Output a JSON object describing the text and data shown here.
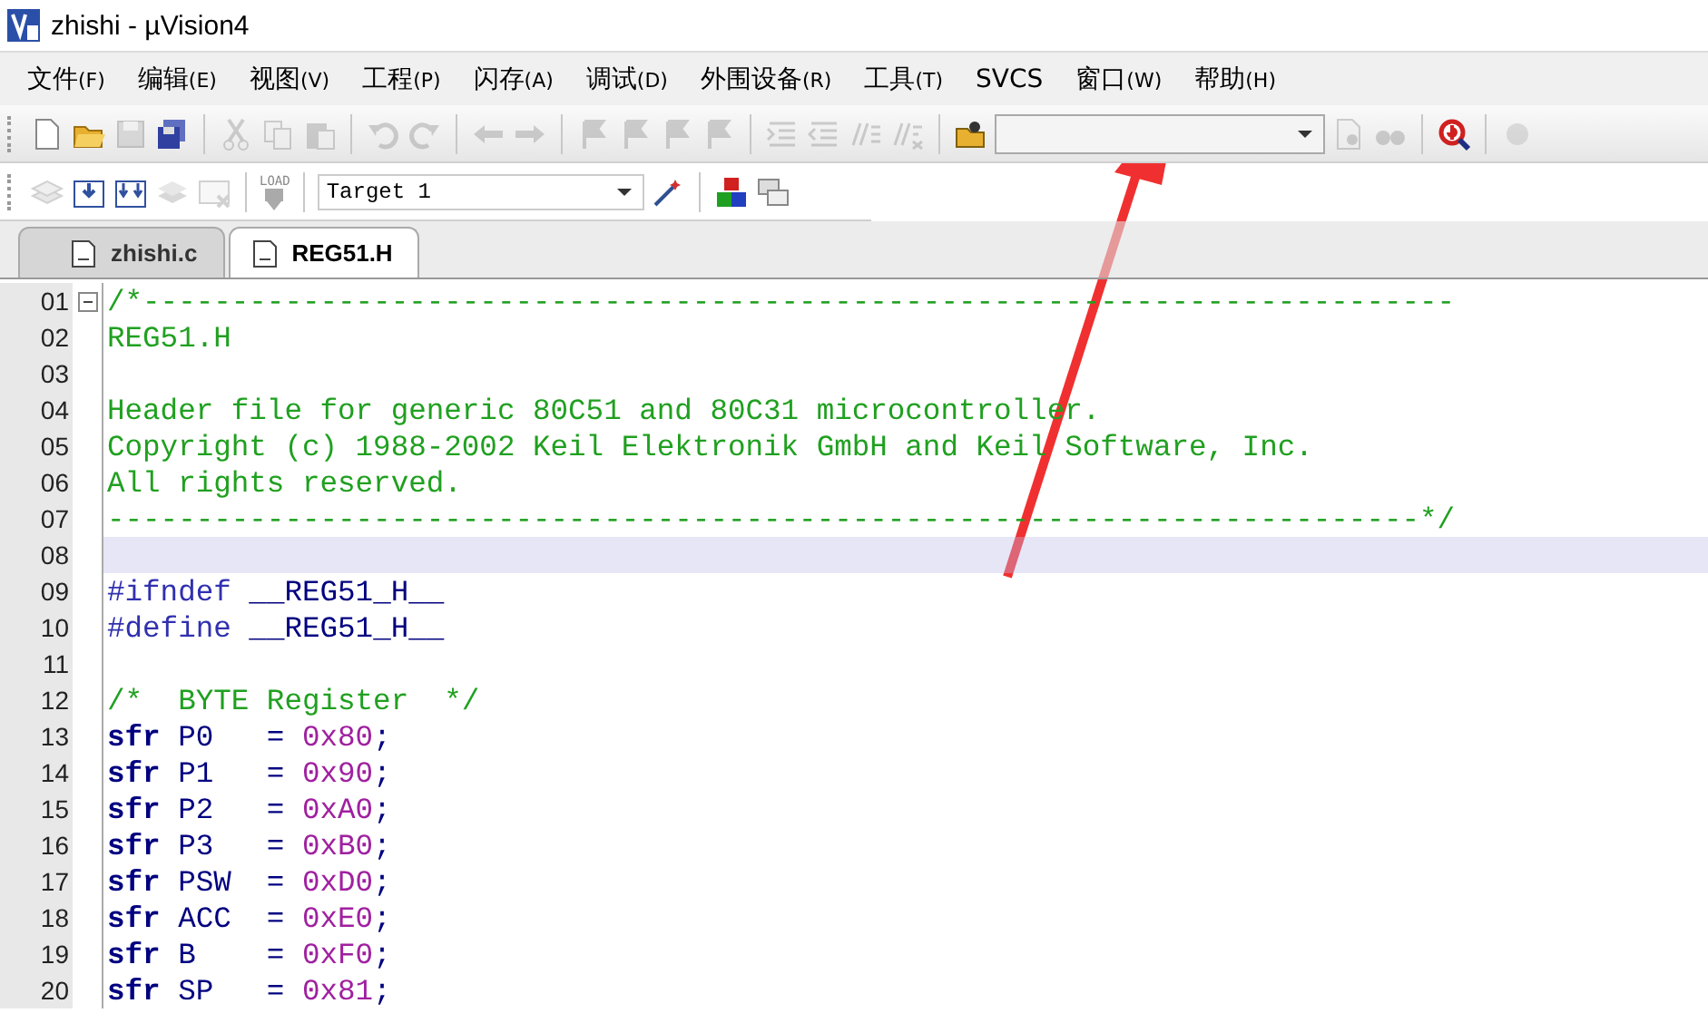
{
  "window": {
    "title": "zhishi  - µVision4"
  },
  "menu": [
    {
      "label": "文件",
      "key": "(F)"
    },
    {
      "label": "编辑",
      "key": "(E)"
    },
    {
      "label": "视图",
      "key": "(V)"
    },
    {
      "label": "工程",
      "key": "(P)"
    },
    {
      "label": "闪存",
      "key": "(A)"
    },
    {
      "label": "调试",
      "key": "(D)"
    },
    {
      "label": "外围设备",
      "key": "(R)"
    },
    {
      "label": "工具",
      "key": "(T)"
    },
    {
      "label": "SVCS"
    },
    {
      "label": "窗口",
      "key": "(W)"
    },
    {
      "label": "帮助",
      "key": "(H)"
    }
  ],
  "build_toolbar": {
    "load_label": "LOAD",
    "target": "Target 1"
  },
  "tabs": [
    {
      "label": "zhishi.c",
      "selected": false
    },
    {
      "label": "REG51.H",
      "selected": true
    }
  ],
  "editor": {
    "lines": [
      {
        "number": "01",
        "current": false,
        "fold": true,
        "tokens": [
          {
            "kind": "comment",
            "text": "/*--------------------------------------------------------------------------"
          }
        ]
      },
      {
        "number": "02",
        "current": false,
        "fold": false,
        "tokens": [
          {
            "kind": "comment",
            "text": "REG51.H"
          }
        ]
      },
      {
        "number": "03",
        "current": false,
        "fold": false
      },
      {
        "number": "04",
        "current": false,
        "fold": false,
        "tokens": [
          {
            "kind": "comment",
            "text": "Header file for generic 80C51 and 80C31 microcontroller."
          }
        ]
      },
      {
        "number": "05",
        "current": false,
        "fold": false,
        "tokens": [
          {
            "kind": "comment",
            "text": "Copyright (c) 1988-2002 Keil Elektronik GmbH and Keil Software, Inc."
          }
        ]
      },
      {
        "number": "06",
        "current": false,
        "fold": false,
        "tokens": [
          {
            "kind": "comment",
            "text": "All rights reserved."
          }
        ]
      },
      {
        "number": "07",
        "current": false,
        "fold": false,
        "tokens": [
          {
            "kind": "comment",
            "text": "--------------------------------------------------------------------------*/"
          }
        ]
      },
      {
        "number": "08",
        "current": true,
        "fold": false
      },
      {
        "number": "09",
        "current": false,
        "fold": false,
        "tokens": [
          {
            "kind": "directive",
            "text": "#ifndef"
          },
          {
            "kind": "plain",
            "text": " __REG51_H__"
          }
        ]
      },
      {
        "number": "10",
        "current": false,
        "fold": false,
        "tokens": [
          {
            "kind": "directive",
            "text": "#define"
          },
          {
            "kind": "plain",
            "text": " __REG51_H__"
          }
        ]
      },
      {
        "number": "11",
        "current": false,
        "fold": false
      },
      {
        "number": "12",
        "current": false,
        "fold": false,
        "tokens": [
          {
            "kind": "comment",
            "text": "/*  BYTE Register  */"
          }
        ]
      },
      {
        "number": "13",
        "current": false,
        "fold": false,
        "tokens": [
          {
            "kind": "keyword",
            "text": "sfr"
          },
          {
            "kind": "plain",
            "text": " P0   = "
          },
          {
            "kind": "number",
            "text": "0x80"
          },
          {
            "kind": "plain",
            "text": ";"
          }
        ]
      },
      {
        "number": "14",
        "current": false,
        "fold": false,
        "tokens": [
          {
            "kind": "keyword",
            "text": "sfr"
          },
          {
            "kind": "plain",
            "text": " P1   = "
          },
          {
            "kind": "number",
            "text": "0x90"
          },
          {
            "kind": "plain",
            "text": ";"
          }
        ]
      },
      {
        "number": "15",
        "current": false,
        "fold": false,
        "tokens": [
          {
            "kind": "keyword",
            "text": "sfr"
          },
          {
            "kind": "plain",
            "text": " P2   = "
          },
          {
            "kind": "number",
            "text": "0xA0"
          },
          {
            "kind": "plain",
            "text": ";"
          }
        ]
      },
      {
        "number": "16",
        "current": false,
        "fold": false,
        "tokens": [
          {
            "kind": "keyword",
            "text": "sfr"
          },
          {
            "kind": "plain",
            "text": " P3   = "
          },
          {
            "kind": "number",
            "text": "0xB0"
          },
          {
            "kind": "plain",
            "text": ";"
          }
        ]
      },
      {
        "number": "17",
        "current": false,
        "fold": false,
        "tokens": [
          {
            "kind": "keyword",
            "text": "sfr"
          },
          {
            "kind": "plain",
            "text": " PSW  = "
          },
          {
            "kind": "number",
            "text": "0xD0"
          },
          {
            "kind": "plain",
            "text": ";"
          }
        ]
      },
      {
        "number": "18",
        "current": false,
        "fold": false,
        "tokens": [
          {
            "kind": "keyword",
            "text": "sfr"
          },
          {
            "kind": "plain",
            "text": " ACC  = "
          },
          {
            "kind": "number",
            "text": "0xE0"
          },
          {
            "kind": "plain",
            "text": ";"
          }
        ]
      },
      {
        "number": "19",
        "current": false,
        "fold": false,
        "tokens": [
          {
            "kind": "keyword",
            "text": "sfr"
          },
          {
            "kind": "plain",
            "text": " B    = "
          },
          {
            "kind": "number",
            "text": "0xF0"
          },
          {
            "kind": "plain",
            "text": ";"
          }
        ]
      },
      {
        "number": "20",
        "current": false,
        "fold": false,
        "tokens": [
          {
            "kind": "keyword",
            "text": "sfr"
          },
          {
            "kind": "plain",
            "text": " SP   = "
          },
          {
            "kind": "number",
            "text": "0x81"
          },
          {
            "kind": "plain",
            "text": ";"
          }
        ]
      }
    ]
  }
}
